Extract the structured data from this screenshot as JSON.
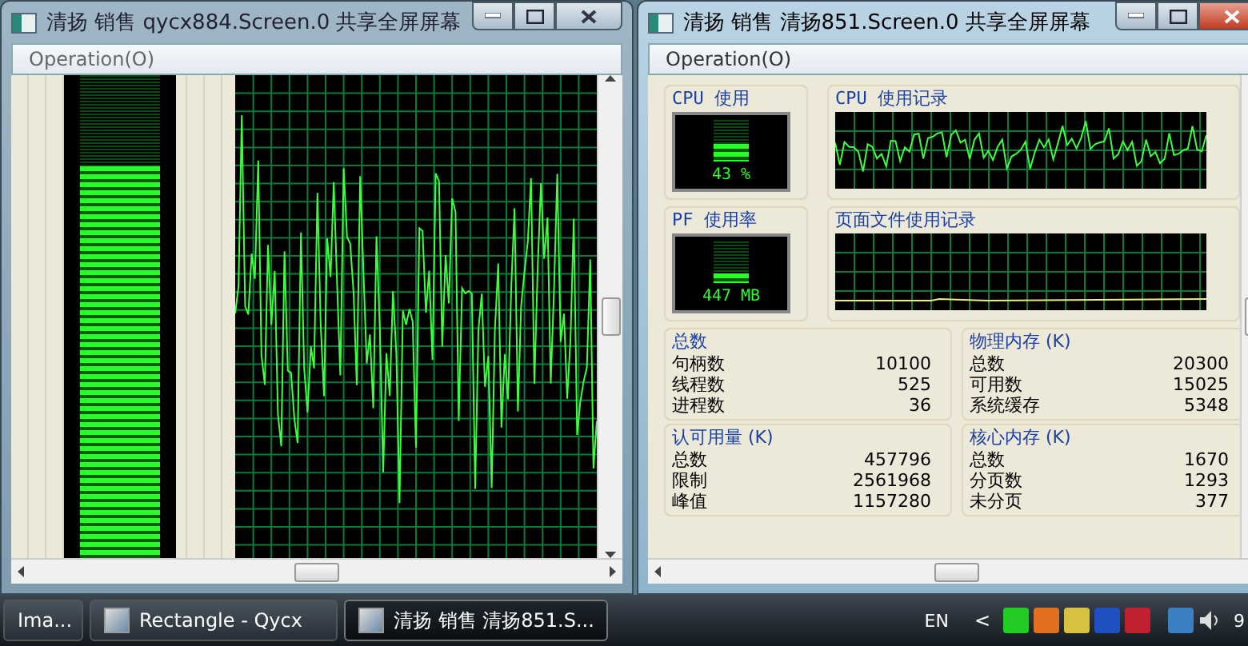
{
  "left_window": {
    "title": "清扬 销售 qycx884.Screen.0 共享全屏屏幕",
    "active": false,
    "menu": [
      "Operation(O)"
    ],
    "meter": {
      "level": 0.81
    }
  },
  "right_window": {
    "title": "清扬 销售 清扬851.Screen.0 共享全屏屏幕",
    "active": true,
    "menu": [
      "Operation(O)"
    ],
    "cpu": {
      "label": "CPU 使用",
      "reading": "43 %",
      "level": 0.43,
      "history_label": "CPU 使用记录"
    },
    "pf": {
      "label": "PF 使用率",
      "reading": "447 MB",
      "level": 0.25,
      "history_label": "页面文件使用记录"
    },
    "groups": [
      {
        "title": "总数",
        "rows": [
          {
            "name": "句柄数",
            "value": "10100"
          },
          {
            "name": "线程数",
            "value": "525"
          },
          {
            "name": "进程数",
            "value": "36"
          }
        ]
      },
      {
        "title": "物理内存 (K)",
        "rows": [
          {
            "name": "总数",
            "value": "20300"
          },
          {
            "name": "可用数",
            "value": "15025"
          },
          {
            "name": "系统缓存",
            "value": "5348"
          }
        ]
      },
      {
        "title": "认可用量 (K)",
        "rows": [
          {
            "name": "总数",
            "value": "457796"
          },
          {
            "name": "限制",
            "value": "2561968"
          },
          {
            "name": "峰值",
            "value": "1157280"
          }
        ]
      },
      {
        "title": "核心内存 (K)",
        "rows": [
          {
            "name": "总数",
            "value": "1670"
          },
          {
            "name": "分页数",
            "value": "1293"
          },
          {
            "name": "未分页",
            "value": "377"
          }
        ]
      }
    ]
  },
  "taskbar": {
    "buttons": [
      {
        "label": "Ima...",
        "selected": false,
        "icon": false
      },
      {
        "label": "Rectangle - Qycx",
        "selected": false,
        "icon": true
      },
      {
        "label": "清扬 销售 清扬851.S...",
        "selected": true,
        "icon": true
      }
    ],
    "language": "EN",
    "tray_arrow": "<",
    "clock": "9"
  }
}
